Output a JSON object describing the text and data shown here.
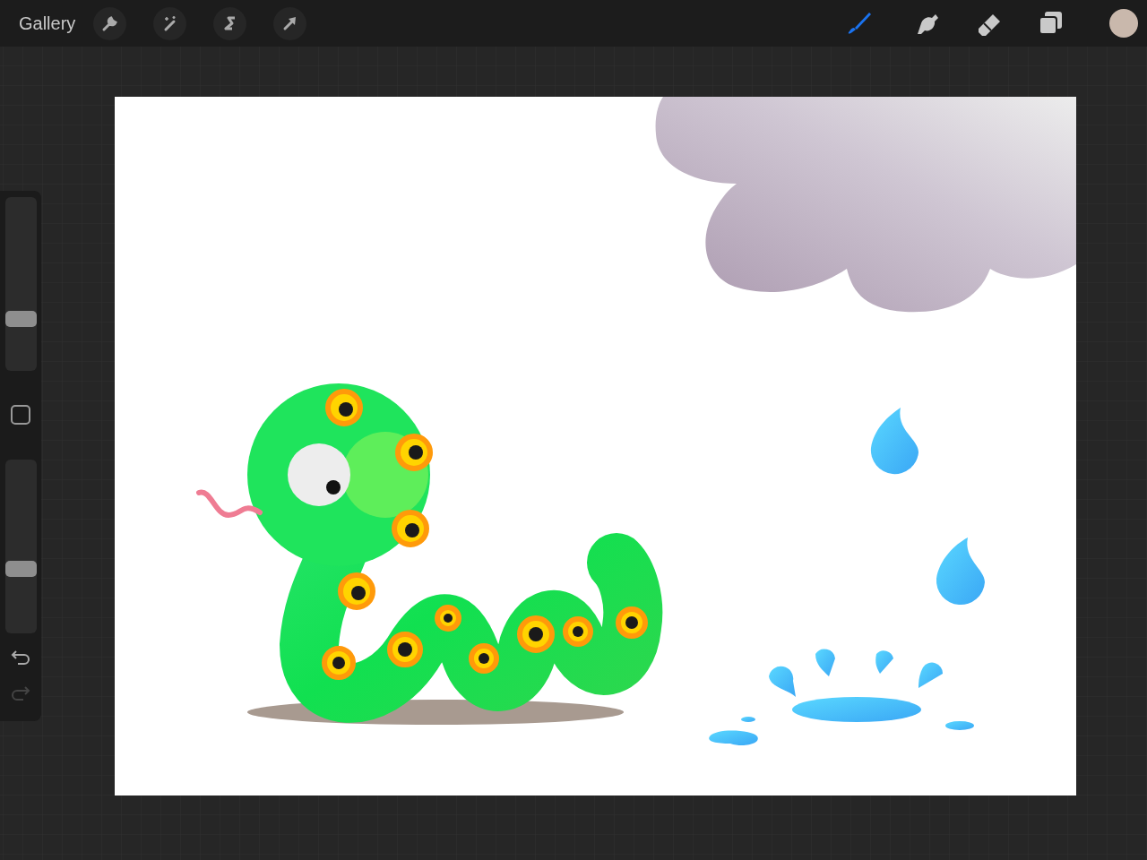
{
  "toolbar": {
    "gallery_label": "Gallery",
    "tools": [
      {
        "kind": "brush",
        "selected": true
      },
      {
        "kind": "smudge",
        "selected": false
      },
      {
        "kind": "eraser",
        "selected": false
      }
    ],
    "color_swatch": {
      "color": "#c9b8ac"
    }
  },
  "sidebar": {
    "sliders": [
      {
        "level": 0.28
      },
      {
        "level": 0.36
      }
    ],
    "undo": {
      "disabled": false
    },
    "redo": {
      "disabled": true
    }
  }
}
